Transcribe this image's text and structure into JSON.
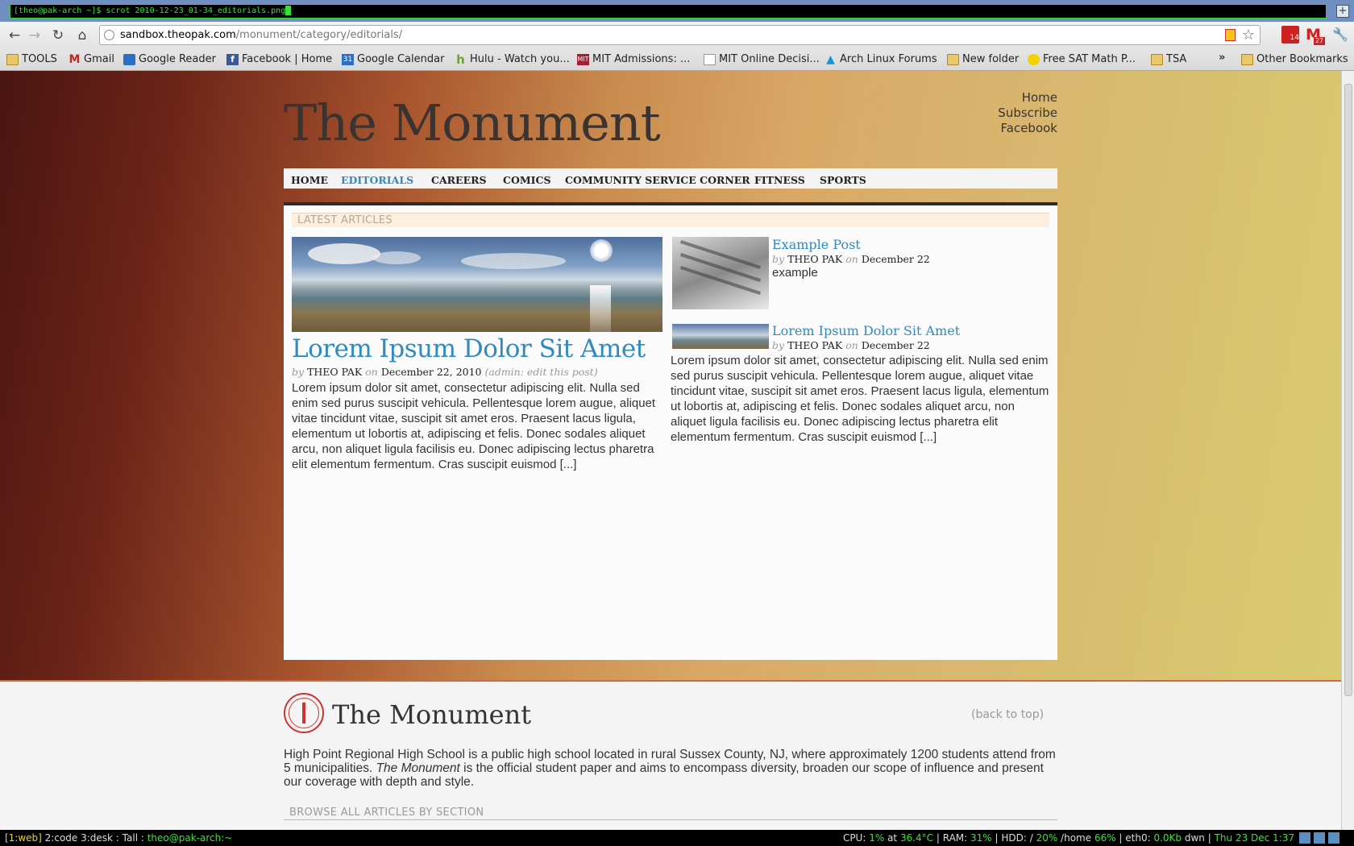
{
  "terminal": {
    "prompt": "[theo@pak-arch ~]$ scrot 2010-12-23_01-34_editorials.png",
    "plus_label": "+"
  },
  "browser": {
    "nav": {
      "back": "←",
      "forward": "→",
      "reload": "↻",
      "home": "⌂"
    },
    "url_host": "sandbox.theopak.com",
    "url_path": "/monument/category/editorials/",
    "ext_pdf_badge": "14",
    "ext_gmail_label": "M",
    "ext_gmail_badge": "27",
    "wrench": "🔧",
    "bookmarks": [
      {
        "label": "TOOLS",
        "icon": "folder-icon"
      },
      {
        "label": "Gmail",
        "icon": "gmail-icon"
      },
      {
        "label": "Google Reader",
        "icon": "google-reader-icon"
      },
      {
        "label": "Facebook | Home",
        "icon": "facebook-icon"
      },
      {
        "label": "Google Calendar",
        "icon": "google-calendar-icon"
      },
      {
        "label": "Hulu - Watch you...",
        "icon": "hulu-icon"
      },
      {
        "label": "MIT Admissions: ...",
        "icon": "mit-icon"
      },
      {
        "label": "MIT Online Decisi...",
        "icon": "document-icon"
      },
      {
        "label": "Arch Linux Forums",
        "icon": "arch-icon"
      },
      {
        "label": "New folder",
        "icon": "folder-icon"
      },
      {
        "label": "Free SAT Math P...",
        "icon": "sat-icon"
      },
      {
        "label": "TSA",
        "icon": "folder-icon"
      }
    ],
    "bookmarks_more": "»",
    "other_bookmarks": "Other Bookmarks"
  },
  "site": {
    "title": "The Monument",
    "top_links": [
      "Home",
      "Subscribe",
      "Facebook"
    ],
    "nav": [
      "HOME",
      "EDITORIALS",
      "CAREERS",
      "COMICS",
      "COMMUNITY SERVICE CORNER",
      "FITNESS",
      "SPORTS"
    ],
    "nav_active": "EDITORIALS",
    "latest_heading": "LATEST ARTICLES",
    "featured": {
      "title": "Lorem Ipsum Dolor Sit Amet",
      "by": "by",
      "author": "THEO PAK",
      "on": "on",
      "date": "December 22, 2010",
      "edit": "(admin: edit this post)",
      "excerpt": "Lorem ipsum dolor sit amet, consectetur adipiscing elit. Nulla sed enim sed purus suscipit vehicula. Pellentesque lorem augue, aliquet vitae tincidunt vitae, suscipit sit amet eros. Praesent lacus ligula, elementum ut lobortis at, adipiscing et felis. Donec sodales aliquet arcu, non aliquet ligula facilisis eu. Donec adipiscing lectus pharetra elit elementum fermentum. Cras suscipit euismod [...]"
    },
    "side_posts": [
      {
        "title": "Example Post",
        "by": "by",
        "author": "THEO PAK",
        "on": "on",
        "date": "December 22",
        "excerpt": "example"
      },
      {
        "title": "Lorem Ipsum Dolor Sit Amet",
        "by": "by",
        "author": "THEO PAK",
        "on": "on",
        "date": "December 22",
        "excerpt": "Lorem ipsum dolor sit amet, consectetur adipiscing elit. Nulla sed enim sed purus suscipit vehicula. Pellentesque lorem augue, aliquet vitae tincidunt vitae, suscipit sit amet eros. Praesent lacus ligula, elementum ut lobortis at, adipiscing et felis. Donec sodales aliquet arcu, non aliquet ligula facilisis eu. Donec adipiscing lectus pharetra elit elementum fermentum. Cras suscipit euismod [...]"
      }
    ],
    "footer": {
      "title": "The Monument",
      "back_to_top": "(back to top)",
      "about_before": "High Point Regional High School is a public high school located in rural Sussex County, NJ, where approximately 1200 students attend from 5 municipalities. ",
      "about_italic": "The Monument",
      "about_after": " is the official student paper and aims to encompass diversity, broaden our scope of influence and present our coverage with depth and style.",
      "browse_heading": "BROWSE ALL ARTICLES BY SECTION"
    }
  },
  "statusbar": {
    "workspace_active": "[1:web]",
    "workspaces": " 2:code 3:desk : Tall : ",
    "user": "theo@pak-arch:~",
    "cpu_label": "CPU: ",
    "cpu": "1%",
    "at": " at ",
    "temp": "36.4°C",
    "ram_label": " | RAM: ",
    "ram": "31%",
    "hdd_label": " | HDD: / ",
    "hdd_root": "20%",
    "home_label": " /home ",
    "hdd_home": "66%",
    "eth_label": " | eth0: ",
    "eth": "0.0Kb",
    "dwn": " dwn | ",
    "datetime": "Thu 23 Dec 1:37"
  }
}
